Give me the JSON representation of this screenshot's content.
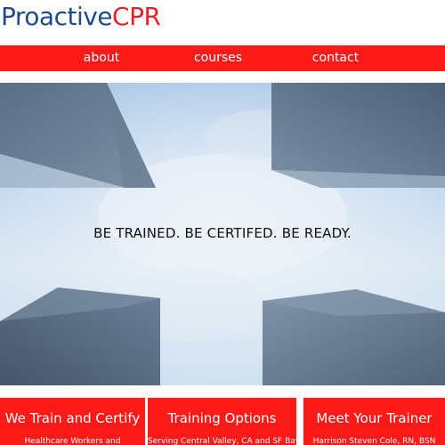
{
  "logo": {
    "part1": "Proactive",
    "part2": "CPR"
  },
  "nav": {
    "items": [
      {
        "label": "about"
      },
      {
        "label": "courses"
      },
      {
        "label": "contact"
      }
    ]
  },
  "hero": {
    "tagline": "BE TRAINED.  BE CERTIFED.  BE READY."
  },
  "cards": [
    {
      "title": "We Train and Certify",
      "text": "Healthcare Workers and"
    },
    {
      "title": "Training Options",
      "text": "Serving Central Valley, CA and SF Bay"
    },
    {
      "title": "Meet Your Trainer",
      "text": "Harrison Steven Cole, RN, BSN"
    }
  ],
  "colors": {
    "brand_blue": "#1f4a8c",
    "brand_red": "#e8202a",
    "nav_red": "#ff1a1a"
  }
}
